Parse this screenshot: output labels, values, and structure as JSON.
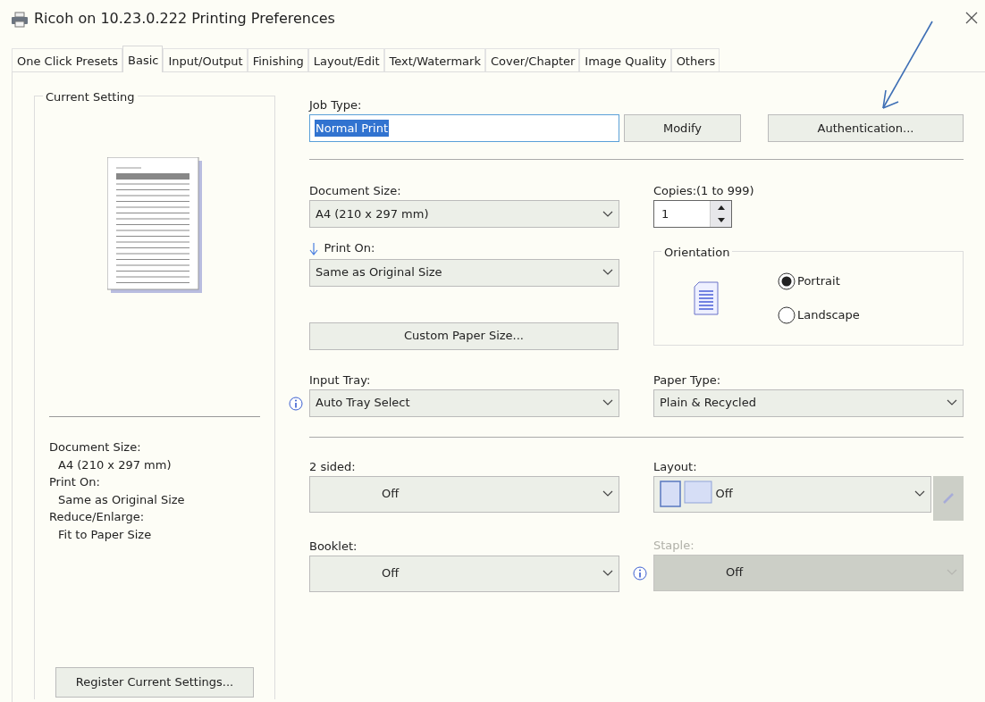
{
  "window": {
    "title": "Ricoh on 10.23.0.222 Printing Preferences"
  },
  "tabs": [
    {
      "label": "One Click Presets",
      "selected": false
    },
    {
      "label": "Basic",
      "selected": true
    },
    {
      "label": "Input/Output",
      "selected": false
    },
    {
      "label": "Finishing",
      "selected": false
    },
    {
      "label": "Layout/Edit",
      "selected": false
    },
    {
      "label": "Text/Watermark",
      "selected": false
    },
    {
      "label": "Cover/Chapter",
      "selected": false
    },
    {
      "label": "Image Quality",
      "selected": false
    },
    {
      "label": "Others",
      "selected": false
    }
  ],
  "current_setting": {
    "title": "Current Setting",
    "summary": [
      {
        "kind": "label",
        "text": "Document Size:"
      },
      {
        "kind": "value",
        "text": "A4 (210 x 297 mm)"
      },
      {
        "kind": "label",
        "text": "Print On:"
      },
      {
        "kind": "value",
        "text": "Same as Original Size"
      },
      {
        "kind": "label",
        "text": "Reduce/Enlarge:"
      },
      {
        "kind": "value",
        "text": "Fit to Paper Size"
      }
    ],
    "register_button": "Register Current Settings..."
  },
  "job_type": {
    "label": "Job Type:",
    "value": "Normal Print",
    "highlighted": true
  },
  "modify_button": "Modify",
  "authentication_button": "Authentication...",
  "document_size": {
    "label": "Document Size:",
    "value": "A4 (210 x 297 mm)"
  },
  "copies": {
    "label": "Copies:(1 to 999)",
    "value": "1"
  },
  "print_on": {
    "label": "Print On:",
    "value": "Same as Original Size"
  },
  "custom_paper_button": "Custom Paper Size...",
  "orientation": {
    "title": "Orientation",
    "options": [
      {
        "label": "Portrait",
        "selected": true
      },
      {
        "label": "Landscape",
        "selected": false
      }
    ]
  },
  "input_tray": {
    "label": "Input Tray:",
    "value": "Auto Tray Select"
  },
  "paper_type": {
    "label": "Paper Type:",
    "value": "Plain & Recycled"
  },
  "two_sided": {
    "label": "2 sided:",
    "value": "Off"
  },
  "layout": {
    "label": "Layout:",
    "value": "Off"
  },
  "booklet": {
    "label": "Booklet:",
    "value": "Off"
  },
  "staple": {
    "label": "Staple:",
    "value": "Off",
    "disabled": true
  }
}
